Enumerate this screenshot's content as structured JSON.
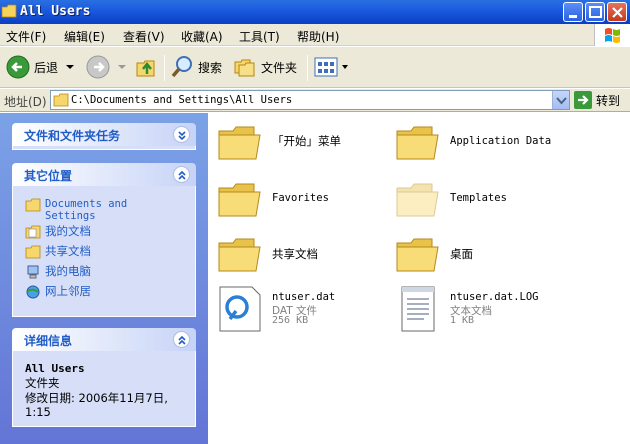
{
  "window": {
    "title": "All Users",
    "icon": "folder-icon"
  },
  "menu": [
    "文件(F)",
    "编辑(E)",
    "查看(V)",
    "收藏(A)",
    "工具(T)",
    "帮助(H)"
  ],
  "toolbar": {
    "back_label": "后退",
    "search_label": "搜索",
    "folders_label": "文件夹"
  },
  "address": {
    "label": "地址(D)",
    "path": "C:\\Documents and Settings\\All Users",
    "go_label": "转到"
  },
  "left_pane": {
    "tasks_title": "文件和文件夹任务",
    "other_places_title": "其它位置",
    "other_places": [
      {
        "label": "Documents and Settings",
        "icon": "folder-icon"
      },
      {
        "label": "我的文档",
        "icon": "my-documents-icon"
      },
      {
        "label": "共享文档",
        "icon": "folder-icon"
      },
      {
        "label": "我的电脑",
        "icon": "my-computer-icon"
      },
      {
        "label": "网上邻居",
        "icon": "network-icon"
      }
    ],
    "details_title": "详细信息",
    "details": {
      "name": "All Users",
      "type": "文件夹",
      "modified": "修改日期: 2006年11月7日, 1:15"
    }
  },
  "items": [
    {
      "name": "「开始」菜单",
      "type": "folder"
    },
    {
      "name": "Application Data",
      "type": "folder"
    },
    {
      "name": "Favorites",
      "type": "folder"
    },
    {
      "name": "Templates",
      "type": "folder-hidden"
    },
    {
      "name": "共享文档",
      "type": "folder"
    },
    {
      "name": "桌面",
      "type": "folder"
    },
    {
      "name": "ntuser.dat",
      "type": "file-dat",
      "kind": "DAT 文件",
      "size": "256 KB"
    },
    {
      "name": "ntuser.dat.LOG",
      "type": "file-text",
      "kind": "文本文档",
      "size": "1 KB"
    }
  ],
  "colors": {
    "titlebar": "#0a3fc2",
    "task_pane": "#7ba2e7",
    "link": "#215dc6",
    "folder": "#f5d76e"
  }
}
